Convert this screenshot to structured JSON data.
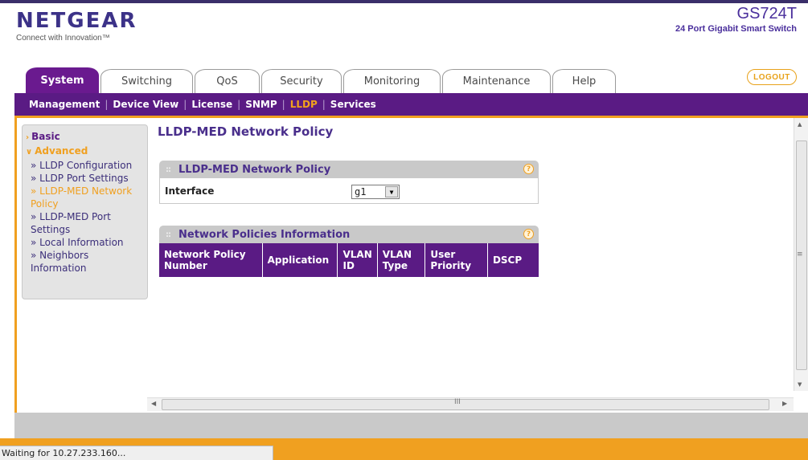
{
  "brand": {
    "logo_text": "NETGEAR",
    "tagline": "Connect with Innovation™",
    "model": "GS724T",
    "model_desc": "24 Port Gigabit Smart Switch",
    "accent_purple": "#5a1b84",
    "accent_orange": "#f0a020"
  },
  "tabs": [
    {
      "label": "System",
      "active": true
    },
    {
      "label": "Switching"
    },
    {
      "label": "QoS"
    },
    {
      "label": "Security"
    },
    {
      "label": "Monitoring"
    },
    {
      "label": "Maintenance"
    },
    {
      "label": "Help"
    }
  ],
  "logout_label": "LOGOUT",
  "subnav": [
    {
      "label": "Management"
    },
    {
      "label": "Device View"
    },
    {
      "label": "License"
    },
    {
      "label": "SNMP"
    },
    {
      "label": "LLDP",
      "active": true
    },
    {
      "label": "Services"
    }
  ],
  "sidebar": {
    "basic": "Basic",
    "advanced": "Advanced",
    "items": [
      {
        "label": "» LLDP Configuration"
      },
      {
        "label": "» LLDP Port Settings"
      },
      {
        "label": "» LLDP-MED Network",
        "active": true
      },
      {
        "label": "Policy",
        "active": true
      },
      {
        "label": "» LLDP-MED Port"
      },
      {
        "label": "Settings"
      },
      {
        "label": "» Local Information"
      },
      {
        "label": "» Neighbors"
      },
      {
        "label": "Information"
      }
    ]
  },
  "page_title": "LLDP-MED Network Policy",
  "policy_panel": {
    "title": "LLDP-MED Network Policy",
    "interface_label": "Interface",
    "interface_value": "g1"
  },
  "info_panel": {
    "title": "Network Policies Information",
    "columns": [
      [
        "Network Policy",
        "Number"
      ],
      [
        "Application"
      ],
      [
        "VLAN",
        "ID"
      ],
      [
        "VLAN",
        "Type"
      ],
      [
        "User",
        "Priority"
      ],
      [
        "DSCP"
      ]
    ]
  },
  "hscroll_grip": "III",
  "status_text": "Waiting for 10.27.233.160..."
}
